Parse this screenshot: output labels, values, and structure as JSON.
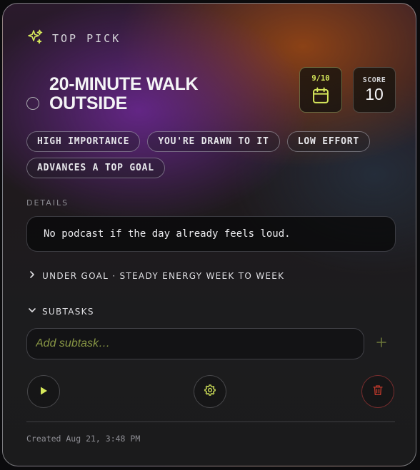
{
  "header": {
    "label": "TOP PICK",
    "icon": "sparkles-icon",
    "accent": "#d6e85b"
  },
  "task": {
    "title": "20-MINUTE WALK OUTSIDE",
    "date_badge": {
      "label": "9/10",
      "icon": "calendar-icon"
    },
    "score": {
      "label": "SCORE",
      "value": "10"
    }
  },
  "chips": [
    "HIGH IMPORTANCE",
    "YOU'RE DRAWN TO IT",
    "LOW EFFORT",
    "ADVANCES A TOP GOAL"
  ],
  "details": {
    "label": "DETAILS",
    "text": "No podcast if the day already feels loud."
  },
  "goal_row": {
    "label": "UNDER GOAL · STEADY ENERGY WEEK TO WEEK",
    "icon": "chevron-right-icon"
  },
  "subtasks": {
    "label": "SUBTASKS",
    "icon": "chevron-down-icon",
    "input_placeholder": "Add subtask…",
    "input_value": ""
  },
  "actions": {
    "play_icon": "play-icon",
    "settings_icon": "gear-icon",
    "delete_icon": "trash-icon",
    "delete_color": "#c0392b"
  },
  "footer": {
    "created": "Created Aug 21, 3:48 PM"
  }
}
